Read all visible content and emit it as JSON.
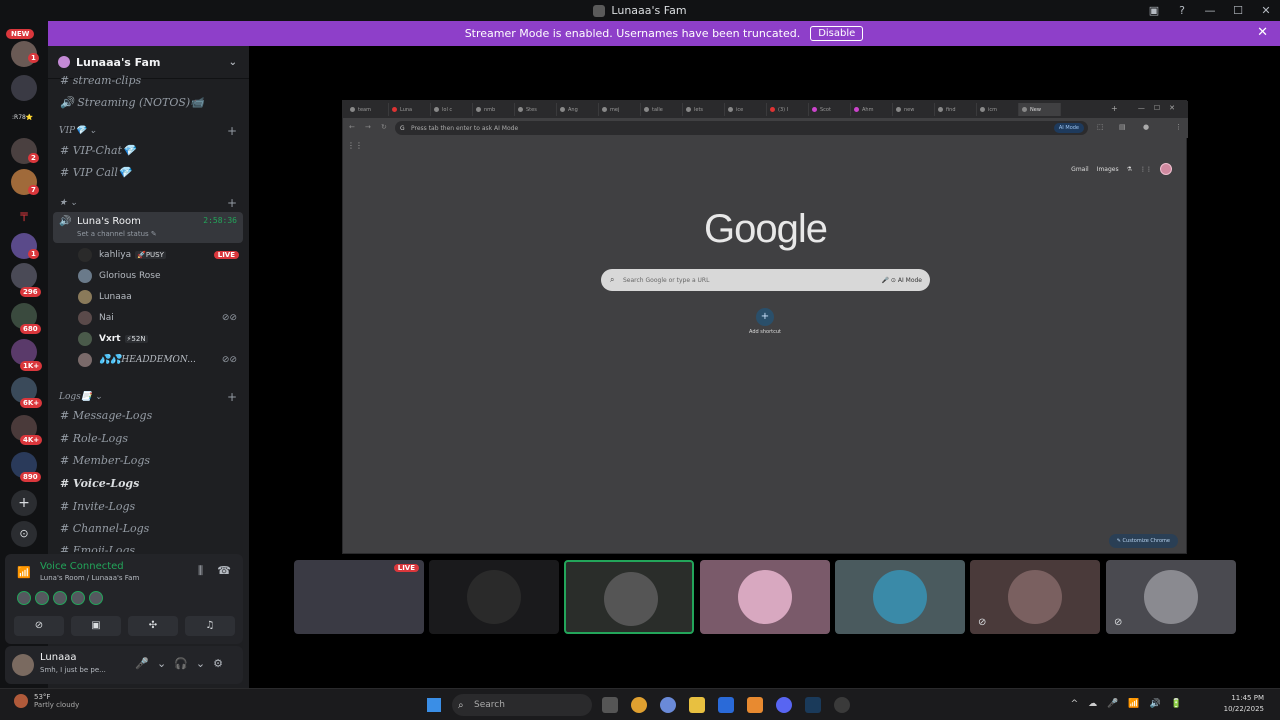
{
  "window": {
    "title": "Lunaaa's Fam"
  },
  "banner": {
    "text": "Streamer Mode is enabled. Usernames have been truncated.",
    "disable_label": "Disable"
  },
  "guilds": {
    "new_label": "NEW",
    "badges": [
      "1",
      "2",
      "7",
      "1",
      "296",
      "680",
      "1K+",
      "6K+",
      "4K+",
      "890"
    ],
    "ticker": ":R78⭐"
  },
  "server": {
    "name": "Lunaaa's Fam"
  },
  "channels": {
    "top": [
      "stream-clips",
      "Streaming (NOTOS)📹"
    ],
    "vip_category": "VIP💎",
    "vip": [
      "VIP-Chat💎",
      "VIP Call💎"
    ],
    "star_category": "★",
    "logs_category": "Logs📑",
    "logs": [
      "Message-Logs",
      "Role-Logs",
      "Member-Logs",
      "Voice-Logs",
      "Invite-Logs",
      "Channel-Logs",
      "Emoji-Logs"
    ]
  },
  "voice_channel": {
    "name": "Luna's Room",
    "timer": "2:58:36",
    "status_placeholder": "Set a channel status",
    "users": [
      {
        "name": "kahliya",
        "tag": "🚀PUSY",
        "live": "LIVE"
      },
      {
        "name": "Glorious Rose"
      },
      {
        "name": "Lunaaa"
      },
      {
        "name": "Nai"
      },
      {
        "name": "Vxrt",
        "tag": "⚡52N"
      },
      {
        "name": "💦💦HEADDEMON..."
      }
    ]
  },
  "voice_panel": {
    "status": "Voice Connected",
    "location": "Luna's Room / Lunaaa's Fam"
  },
  "user_panel": {
    "name": "Lunaaa",
    "status": "Smh, I just be pe..."
  },
  "browser": {
    "tabs": [
      "team",
      "Luna",
      "lol c",
      "nmb",
      "Stes",
      "Ang",
      "mej",
      "talle",
      "lets",
      "ice",
      "(3) I",
      "Scot",
      "Ahm",
      "new",
      "find",
      "icm",
      "New"
    ],
    "omnibox_placeholder": "Press tab then enter to ask AI Mode",
    "ai_mode": "AI Mode",
    "links": [
      "Gmail",
      "Images"
    ],
    "logo": "Google",
    "search_placeholder": "Search Google or type a URL",
    "search_ai": "AI Mode",
    "shortcut_label": "Add shortcut",
    "customize": "Customize Chrome"
  },
  "stream_tiles": {
    "live_label": "LIVE"
  },
  "taskbar": {
    "temp": "53°F",
    "weather": "Partly cloudy",
    "search": "Search",
    "time": "11:45 PM",
    "date": "10/22/2025"
  }
}
